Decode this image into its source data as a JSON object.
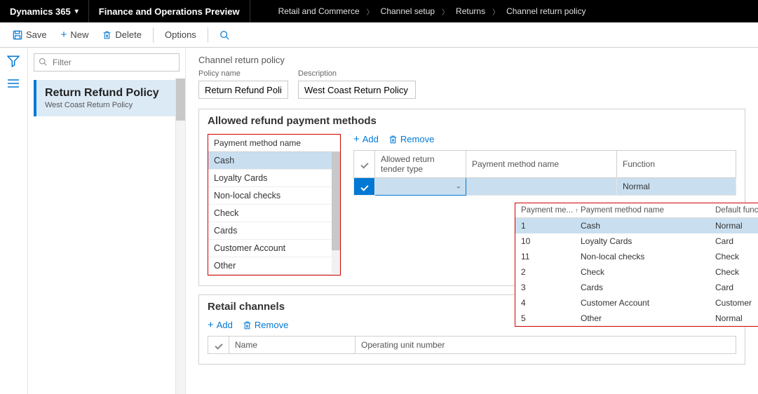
{
  "topbar": {
    "app_name": "Dynamics 365",
    "module_title": "Finance and Operations Preview",
    "breadcrumb": [
      "Retail and Commerce",
      "Channel setup",
      "Returns",
      "Channel return policy"
    ]
  },
  "actionbar": {
    "save_label": "Save",
    "new_label": "New",
    "delete_label": "Delete",
    "options_label": "Options"
  },
  "leftpanel": {
    "filter_placeholder": "Filter",
    "card_title": "Return Refund Policy",
    "card_subtitle": "West Coast Return Policy"
  },
  "page": {
    "title": "Channel return policy",
    "policy_name_label": "Policy name",
    "policy_name_value": "Return Refund Policy",
    "description_label": "Description",
    "description_value": "West Coast Return Policy"
  },
  "allowed_refund": {
    "section_title": "Allowed refund payment methods",
    "pm_header": "Payment method name",
    "pm_items": [
      "Cash",
      "Loyalty Cards",
      "Non-local checks",
      "Check",
      "Cards",
      "Customer Account",
      "Other"
    ],
    "add_label": "Add",
    "remove_label": "Remove",
    "grid_headers": {
      "tender": "Allowed return tender type",
      "name": "Payment method name",
      "function": "Function"
    },
    "grid_row_function": "Normal"
  },
  "lookup": {
    "col1": "Payment me...",
    "col2": "Payment method name",
    "col3": "Default function",
    "rows": [
      {
        "id": "1",
        "name": "Cash",
        "func": "Normal"
      },
      {
        "id": "10",
        "name": "Loyalty Cards",
        "func": "Card"
      },
      {
        "id": "11",
        "name": "Non-local checks",
        "func": "Check"
      },
      {
        "id": "2",
        "name": "Check",
        "func": "Check"
      },
      {
        "id": "3",
        "name": "Cards",
        "func": "Card"
      },
      {
        "id": "4",
        "name": "Customer Account",
        "func": "Customer"
      },
      {
        "id": "5",
        "name": "Other",
        "func": "Normal"
      }
    ]
  },
  "retail": {
    "section_title": "Retail channels",
    "add_label": "Add",
    "remove_label": "Remove",
    "col_name": "Name",
    "col_unit": "Operating unit number"
  }
}
